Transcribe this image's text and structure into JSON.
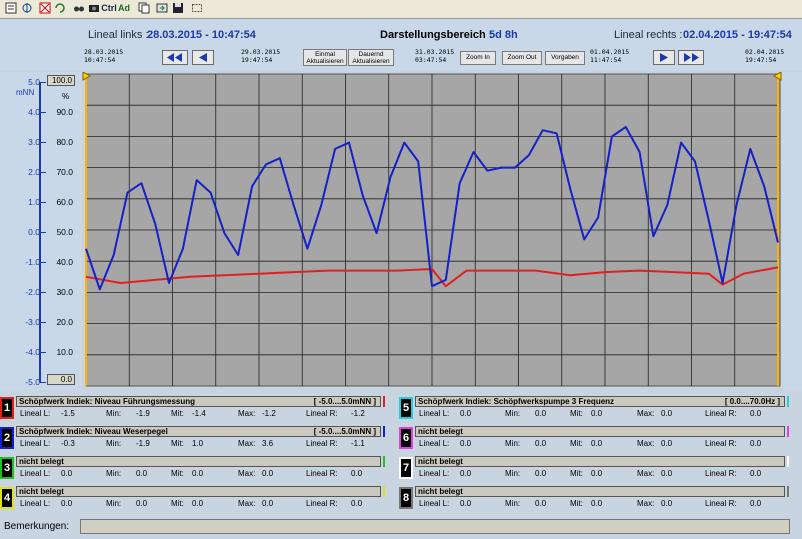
{
  "header": {
    "lineal_links_label": "Lineal links :",
    "lineal_links_value": "28.03.2015 - 10:47:54",
    "darstellung_label": "Darstellungsbereich :",
    "darstellung_value": "5d 8h",
    "lineal_rechts_label": "Lineal rechts :",
    "lineal_rechts_value": "02.04.2015 - 19:47:54",
    "time_marks": [
      {
        "date": "28.03.2015",
        "time": "10:47:54"
      },
      {
        "date": "29.03.2015",
        "time": "19:47:54"
      },
      {
        "date": "31.03.2015",
        "time": "03:47:54"
      },
      {
        "date": "01.04.2015",
        "time": "11:47:54"
      },
      {
        "date": "02.04.2015",
        "time": "19:47:54"
      }
    ],
    "buttons": {
      "einmal_line1": "Einmal",
      "einmal_line2": "Aktualisieren",
      "dauernd_line1": "Dauernd",
      "dauernd_line2": "Aktualisieren",
      "zoom_in": "Zoom In",
      "zoom_out": "Zoom Out",
      "vorgaben": "Vorgaben"
    }
  },
  "y_axis_left": {
    "unit": "mNN",
    "ticks": [
      "5.0",
      "4.0",
      "3.0",
      "2.0",
      "1.0",
      "0.0",
      "-1.0",
      "-2.0",
      "-3.0",
      "-4.0",
      "-5.0"
    ],
    "color": "#1a3ab0"
  },
  "y_axis_right": {
    "unit": "%",
    "top_box": "100.0",
    "bottom_box": "0.0",
    "ticks": [
      "90.0",
      "80.0",
      "70.0",
      "60.0",
      "50.0",
      "40.0",
      "30.0",
      "20.0",
      "10.0"
    ]
  },
  "chart_data": {
    "type": "line",
    "x_range": [
      "28.03.2015 10:47:54",
      "02.04.2015 19:47:54"
    ],
    "ylim_left": [
      -5,
      5
    ],
    "ylim_right": [
      0,
      100
    ],
    "grid": true,
    "series": [
      {
        "name": "Schöpfwerk Indiek: Niveau Weserpegel",
        "color": "#1520c8",
        "x_frac": [
          0,
          0.02,
          0.04,
          0.06,
          0.08,
          0.1,
          0.12,
          0.14,
          0.16,
          0.18,
          0.2,
          0.22,
          0.24,
          0.26,
          0.28,
          0.3,
          0.32,
          0.34,
          0.36,
          0.38,
          0.4,
          0.42,
          0.44,
          0.46,
          0.48,
          0.5,
          0.52,
          0.54,
          0.56,
          0.58,
          0.6,
          0.62,
          0.64,
          0.66,
          0.68,
          0.7,
          0.72,
          0.74,
          0.76,
          0.78,
          0.8,
          0.82,
          0.84,
          0.86,
          0.88,
          0.9,
          0.92,
          0.94,
          0.96,
          0.98,
          1.0
        ],
        "values": [
          -0.6,
          -1.9,
          -0.8,
          1.2,
          1.5,
          0.2,
          -1.7,
          -0.6,
          1.6,
          1.2,
          -0.1,
          -0.8,
          1.4,
          2.1,
          2.3,
          0.8,
          -0.6,
          0.8,
          2.6,
          2.8,
          1.1,
          -0.1,
          1.7,
          2.8,
          2.2,
          -1.8,
          -1.6,
          1.5,
          2.5,
          1.9,
          2.0,
          2.0,
          2.4,
          3.2,
          3.1,
          1.3,
          -0.3,
          0.4,
          3.0,
          3.3,
          2.5,
          -0.2,
          0.8,
          2.8,
          2.2,
          0.3,
          -1.7,
          0.8,
          2.6,
          1.4,
          -0.4
        ]
      },
      {
        "name": "Schöpfwerk Indiek: Niveau Führungsmessung",
        "color": "#e02020",
        "x_frac": [
          0,
          0.05,
          0.1,
          0.15,
          0.2,
          0.25,
          0.3,
          0.35,
          0.4,
          0.45,
          0.5,
          0.52,
          0.55,
          0.6,
          0.65,
          0.7,
          0.75,
          0.8,
          0.85,
          0.9,
          0.92,
          0.95,
          1.0
        ],
        "values": [
          -1.5,
          -1.7,
          -1.6,
          -1.5,
          -1.45,
          -1.4,
          -1.35,
          -1.3,
          -1.3,
          -1.3,
          -1.25,
          -1.8,
          -1.3,
          -1.3,
          -1.3,
          -1.45,
          -1.35,
          -1.3,
          -1.35,
          -1.4,
          -1.75,
          -1.4,
          -1.2
        ]
      }
    ]
  },
  "panels": [
    {
      "num": "1",
      "color": "#e02020",
      "bg": "#000",
      "title": "Schöpfwerk Indiek: Niveau Führungsmessung",
      "range": "[ -5.0....5.0mNN ]",
      "lineal_l": "-1.5",
      "min": "-1.9",
      "mit": "-1.4",
      "max": "-1.2",
      "lineal_r": "-1.2"
    },
    {
      "num": "2",
      "color": "#1520c8",
      "bg": "#000",
      "title": "Schöpfwerk Indiek: Niveau Weserpegel",
      "range": "[ -5.0....5.0mNN ]",
      "lineal_l": "-0.3",
      "min": "-1.9",
      "mit": "1.0",
      "max": "3.6",
      "lineal_r": "-1.1"
    },
    {
      "num": "3",
      "color": "#20c020",
      "bg": "#000",
      "title": "nicht belegt",
      "range": "",
      "lineal_l": "0.0",
      "min": "0.0",
      "mit": "0.0",
      "max": "0.0",
      "lineal_r": "0.0"
    },
    {
      "num": "4",
      "color": "#e0e020",
      "bg": "#000",
      "title": "nicht belegt",
      "range": "",
      "lineal_l": "0.0",
      "min": "0.0",
      "mit": "0.0",
      "max": "0.0",
      "lineal_r": "0.0"
    },
    {
      "num": "5",
      "color": "#20d0e0",
      "bg": "#000",
      "title": "Schöpfwerk Indiek: Schöpfwerkspumpe 3 Frequenz",
      "range": "[ 0.0....70.0Hz ]",
      "lineal_l": "0.0",
      "min": "0.0",
      "mit": "0.0",
      "max": "0.0",
      "lineal_r": "0.0"
    },
    {
      "num": "6",
      "color": "#e040e0",
      "bg": "#000",
      "title": "nicht belegt",
      "range": "",
      "lineal_l": "0.0",
      "min": "0.0",
      "mit": "0.0",
      "max": "0.0",
      "lineal_r": "0.0"
    },
    {
      "num": "7",
      "color": "#ffffff",
      "bg": "#000",
      "title": "nicht belegt",
      "range": "",
      "lineal_l": "0.0",
      "min": "0.0",
      "mit": "0.0",
      "max": "0.0",
      "lineal_r": "0.0"
    },
    {
      "num": "8",
      "color": "#777777",
      "bg": "#000",
      "title": "nicht belegt",
      "range": "",
      "lineal_l": "0.0",
      "min": "0.0",
      "mit": "0.0",
      "max": "0.0",
      "lineal_r": "0.0"
    }
  ],
  "labels": {
    "lineal_l": "Lineal L:",
    "min": "Min:",
    "mit": "Mit:",
    "max": "Max:",
    "lineal_r": "Lineal R:"
  },
  "bemerkungen_label": "Bemerkungen:",
  "toolbar_icons": [
    "properties-icon",
    "navigate-icon",
    "cut-icon",
    "refresh-icon",
    "binoculars-icon",
    "camera-icon",
    "ctrl-icon",
    "add-icon",
    "copy-icon",
    "export-icon",
    "save-icon",
    "frame-icon"
  ],
  "toolbar_text": {
    "ctrl": "Ctrl",
    "add": "Ad"
  }
}
